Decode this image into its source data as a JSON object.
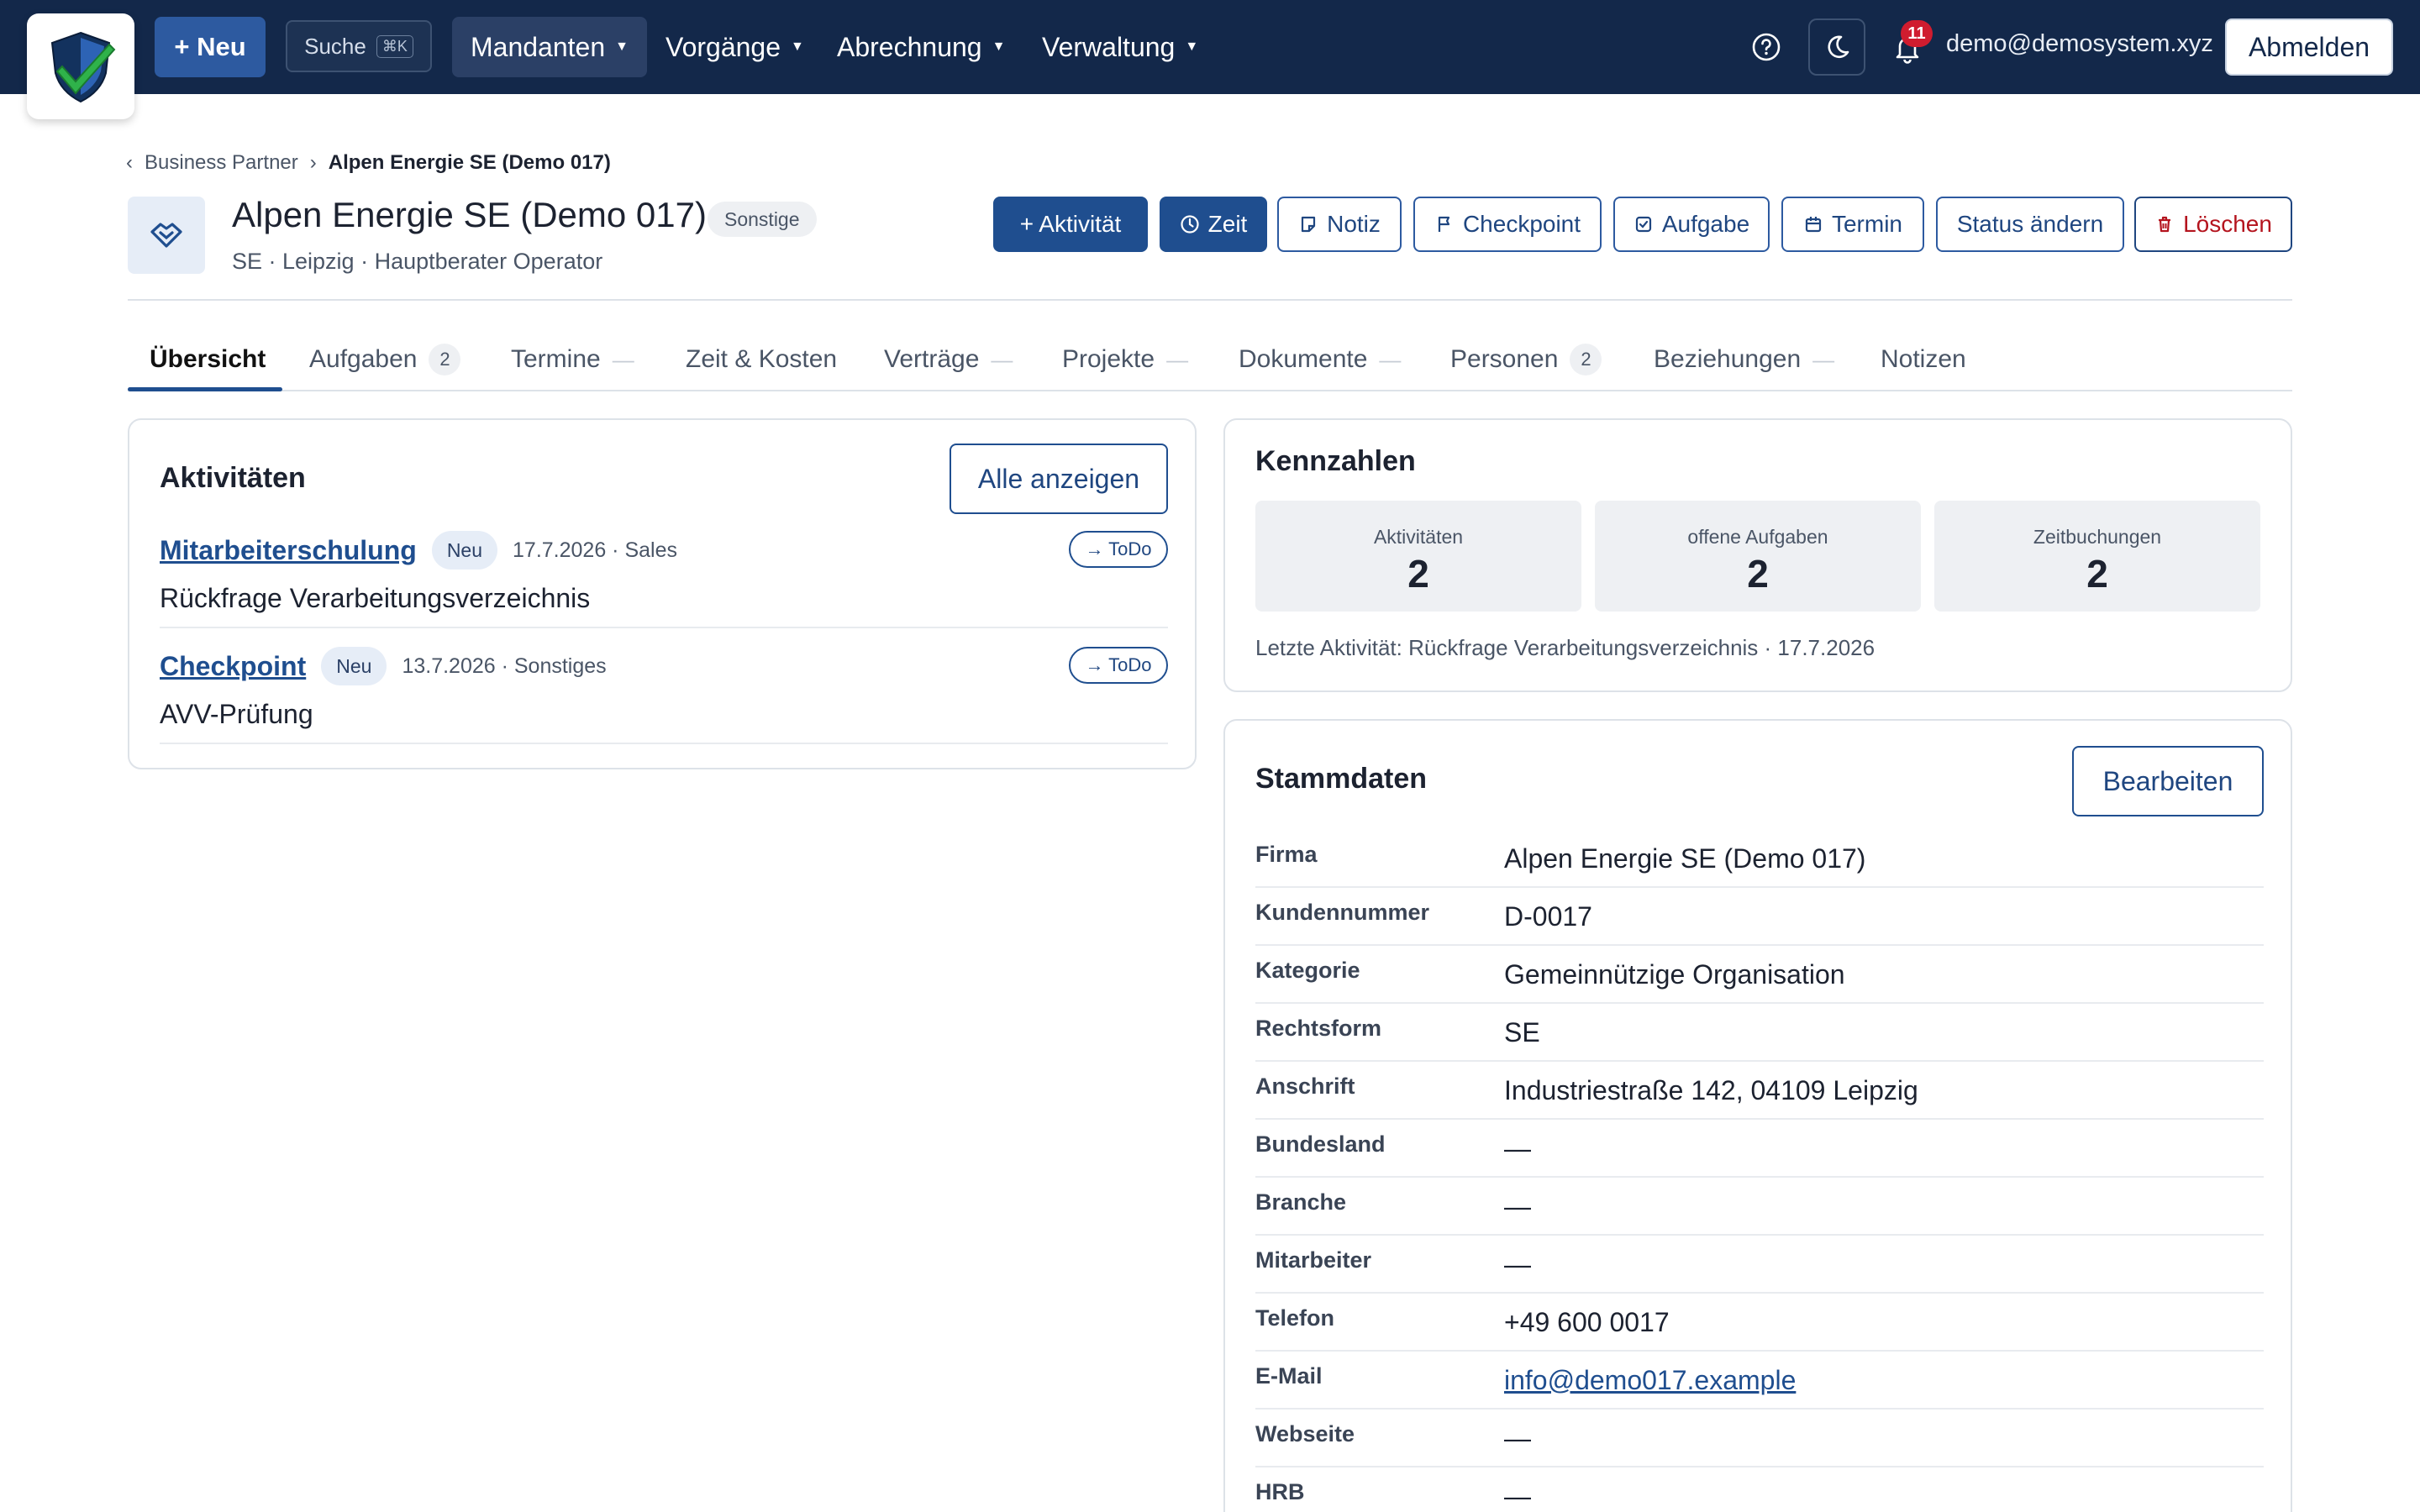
{
  "nav": {
    "new_label": "+ Neu",
    "search_label": "Suche",
    "search_shortcut": "⌘K",
    "menus": [
      {
        "label": "Mandanten"
      },
      {
        "label": "Vorgänge"
      },
      {
        "label": "Abrechnung"
      },
      {
        "label": "Verwaltung"
      }
    ],
    "notification_count": "11",
    "user_email": "demo@demosystem.xyz",
    "logout_label": "Abmelden"
  },
  "breadcrumb": {
    "parent": "Business Partner",
    "current": "Alpen Energie SE (Demo 017)"
  },
  "header": {
    "title": "Alpen Energie SE (Demo 017)",
    "category_badge": "Sonstige",
    "subtitle": "SE · Leipzig · Hauptberater Operator",
    "actions": {
      "aktivitaet": "+ Aktivität",
      "zeit": "Zeit",
      "notiz": "Notiz",
      "checkpoint": "Checkpoint",
      "aufgabe": "Aufgabe",
      "termin": "Termin",
      "status": "Status ändern",
      "loeschen": "Löschen"
    }
  },
  "tabs": [
    {
      "label": "Übersicht"
    },
    {
      "label": "Aufgaben",
      "count": "2"
    },
    {
      "label": "Termine"
    },
    {
      "label": "Zeit & Kosten"
    },
    {
      "label": "Verträge"
    },
    {
      "label": "Projekte"
    },
    {
      "label": "Dokumente"
    },
    {
      "label": "Personen",
      "count": "2"
    },
    {
      "label": "Beziehungen"
    },
    {
      "label": "Notizen"
    }
  ],
  "activities": {
    "title": "Aktivitäten",
    "show_all": "Alle anzeigen",
    "items": [
      {
        "name": "Mitarbeiterschulung",
        "badge": "Neu",
        "meta": "17.7.2026 · Sales",
        "desc": "Rückfrage Verarbeitungsverzeichnis",
        "todo": "→ ToDo"
      },
      {
        "name": "Checkpoint",
        "badge": "Neu",
        "meta": "13.7.2026 · Sonstiges",
        "desc": "AVV-Prüfung",
        "todo": "→ ToDo"
      }
    ]
  },
  "kpis": {
    "title": "Kennzahlen",
    "items": [
      {
        "label": "Aktivitäten",
        "value": "2"
      },
      {
        "label": "offene Aufgaben",
        "value": "2"
      },
      {
        "label": "Zeitbuchungen",
        "value": "2"
      }
    ],
    "last_activity": "Letzte Aktivität: Rückfrage Verarbeitungsverzeichnis · 17.7.2026"
  },
  "master": {
    "title": "Stammdaten",
    "edit_label": "Bearbeiten",
    "fields": [
      {
        "label": "Firma",
        "value": "Alpen Energie SE (Demo 017)"
      },
      {
        "label": "Kundennummer",
        "value": "D-0017"
      },
      {
        "label": "Kategorie",
        "value": "Gemeinnützige Organisation"
      },
      {
        "label": "Rechtsform",
        "value": "SE"
      },
      {
        "label": "Anschrift",
        "value": "Industriestraße 142, 04109 Leipzig"
      },
      {
        "label": "Bundesland",
        "value": "—"
      },
      {
        "label": "Branche",
        "value": "—"
      },
      {
        "label": "Mitarbeiter",
        "value": "—"
      },
      {
        "label": "Telefon",
        "value": "+49 600 0017"
      },
      {
        "label": "E-Mail",
        "value": "info@demo017.example"
      },
      {
        "label": "Webseite",
        "value": "—"
      },
      {
        "label": "HRB",
        "value": "—"
      }
    ]
  },
  "colors": {
    "nav_bg": "#13284a",
    "primary": "#1f4e8f",
    "danger": "#b4141e",
    "badge_red": "#d01c2f"
  }
}
